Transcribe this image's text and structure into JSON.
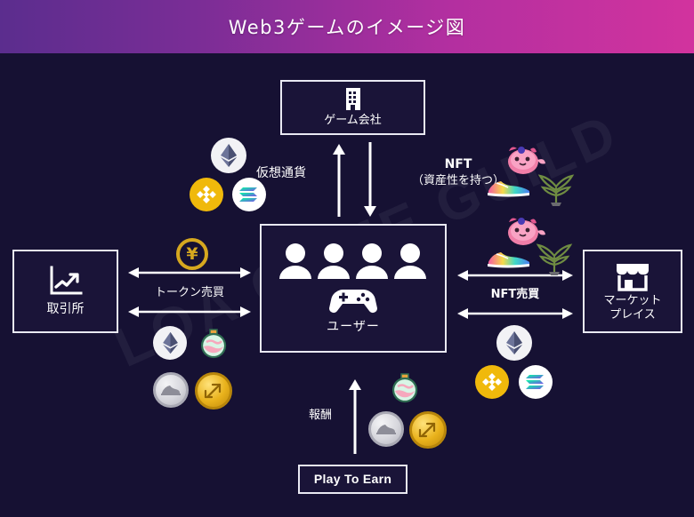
{
  "header": {
    "title": "Web3ゲームのイメージ図",
    "gradient_from": "#5b2d8e",
    "gradient_to": "#d2339e"
  },
  "canvas": {
    "background": "#161133",
    "watermark": "LOA GAME GUILD"
  },
  "nodes": {
    "company": {
      "label": "ゲーム会社",
      "icon": "building-icon"
    },
    "users": {
      "label": "ユーザー",
      "icon": "people-group-icon",
      "secondary_icon": "gamepad-icon"
    },
    "exchange": {
      "label": "取引所",
      "icon": "chart-growth-icon"
    },
    "marketplace": {
      "label_line1": "マーケット",
      "label_line2": "プレイス",
      "icon": "storefront-icon"
    },
    "play_to_earn": {
      "label": "Play To Earn"
    }
  },
  "edges": {
    "crypto_up": {
      "label": "仮想通貨",
      "direction": "up"
    },
    "nft_down": {
      "label": "NFT",
      "sublabel": "（資産性を持つ）",
      "direction": "down"
    },
    "token_trade": {
      "label": "トークン売買",
      "direction": "bidirectional"
    },
    "nft_trade": {
      "label": "NFT売買",
      "direction": "bidirectional"
    },
    "reward": {
      "label": "報酬",
      "direction": "up"
    }
  },
  "assets": {
    "coins": [
      {
        "name": "ethereum",
        "symbol": "ETH",
        "color": "#f2f2f5"
      },
      {
        "name": "binance",
        "symbol": "BNB",
        "color": "#f0b90b"
      },
      {
        "name": "solana",
        "symbol": "SOL",
        "color": "#ffffff"
      },
      {
        "name": "yen",
        "symbol": "¥",
        "color": "#d6a81f"
      },
      {
        "name": "sneaker-token",
        "symbol": "",
        "color": "#d7d7dd"
      },
      {
        "name": "gold-token",
        "symbol": "",
        "color": "#e9b21c"
      }
    ],
    "nft_items": [
      {
        "name": "axie-creature",
        "color": "#f58bb0"
      },
      {
        "name": "sneaker",
        "color": "#36d6c3"
      },
      {
        "name": "plant",
        "color": "#7f9c4a"
      },
      {
        "name": "potion",
        "color": "#7fd6b0"
      }
    ]
  }
}
